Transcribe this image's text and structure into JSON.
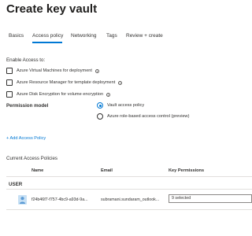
{
  "header": {
    "title": "Create key vault"
  },
  "tabs": [
    {
      "label": "Basics"
    },
    {
      "label": "Access policy"
    },
    {
      "label": "Networking"
    },
    {
      "label": "Tags"
    },
    {
      "label": "Review + create"
    }
  ],
  "enable_access": {
    "label": "Enable Access to:",
    "options": [
      {
        "label": "Azure Virtual Machines for deployment",
        "checked": false
      },
      {
        "label": "Azure Resource Manager for template deployment",
        "checked": false
      },
      {
        "label": "Azure Disk Encryption for volume encryption",
        "checked": false
      }
    ]
  },
  "permission_model": {
    "label": "Permission model",
    "options": [
      {
        "label": "Vault access policy",
        "selected": true
      },
      {
        "label": "Azure role-based access control (preview)",
        "selected": false
      }
    ]
  },
  "add_access_policy": {
    "label": "+ Add Access Policy"
  },
  "current_policies": {
    "label": "Current Access Policies",
    "columns": [
      "Name",
      "Email",
      "Key Permissions"
    ],
    "group_label": "USER",
    "rows": [
      {
        "name": "f24b46f7-f757-4bc9-a93d-9a...",
        "email": "subramani.sundaram_outlook...",
        "key_permissions": "9 selected"
      }
    ]
  },
  "colors": {
    "accent": "#0078d4",
    "text": "#323130",
    "divider": "#e1dfdd"
  },
  "icons": {
    "info": "info-icon",
    "user_avatar": "user-avatar-icon"
  }
}
